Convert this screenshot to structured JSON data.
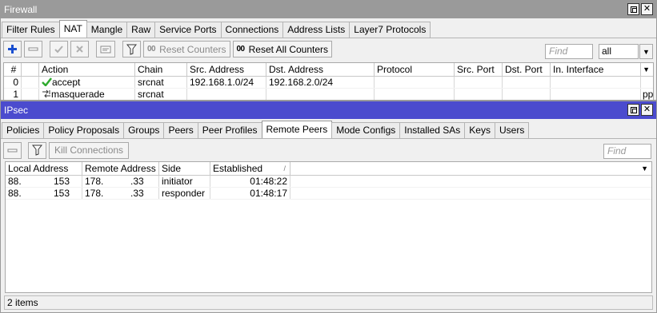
{
  "firewall": {
    "title": "Firewall",
    "tabs": [
      "Filter Rules",
      "NAT",
      "Mangle",
      "Raw",
      "Service Ports",
      "Connections",
      "Address Lists",
      "Layer7 Protocols"
    ],
    "active_tab": "NAT",
    "toolbar": {
      "reset_counters": "Reset Counters",
      "reset_all_counters": "Reset All Counters",
      "counter_glyph": "00",
      "find_placeholder": "Find",
      "filter_value": "all"
    },
    "columns": [
      "#",
      "",
      "Action",
      "Chain",
      "Src. Address",
      "Dst. Address",
      "Protocol",
      "Src. Port",
      "Dst. Port",
      "In. Interface"
    ],
    "rows": [
      {
        "num": "0",
        "action": "accept",
        "chain": "srcnat",
        "src": "192.168.1.0/24",
        "dst": "192.168.2.0/24",
        "protocol": "",
        "sport": "",
        "dport": "",
        "iface": ""
      },
      {
        "num": "1",
        "action": "masquerade",
        "chain": "srcnat",
        "src": "",
        "dst": "",
        "protocol": "",
        "sport": "",
        "dport": "",
        "iface": "pp"
      }
    ]
  },
  "ipsec": {
    "title": "IPsec",
    "tabs": [
      "Policies",
      "Policy Proposals",
      "Groups",
      "Peers",
      "Peer Profiles",
      "Remote Peers",
      "Mode Configs",
      "Installed SAs",
      "Keys",
      "Users"
    ],
    "active_tab": "Remote Peers",
    "toolbar": {
      "kill_connections": "Kill Connections",
      "find_placeholder": "Find"
    },
    "columns": [
      "Local Address",
      "Remote Address",
      "Side",
      "Established"
    ],
    "rows": [
      {
        "local_a": "88.",
        "local_b": "153",
        "remote_a": "178.",
        "remote_b": ".33",
        "side": "initiator",
        "established": "01:48:22"
      },
      {
        "local_a": "88.",
        "local_b": "153",
        "remote_a": "178.",
        "remote_b": ".33",
        "side": "responder",
        "established": "01:48:17"
      }
    ],
    "status": "2 items"
  },
  "colors": {
    "ipsec_title_bg": "#4b4bce",
    "firewall_title_bg": "#9a9a9a",
    "add_icon": "#1a4fd0",
    "accept_check": "#2eaa2e"
  }
}
